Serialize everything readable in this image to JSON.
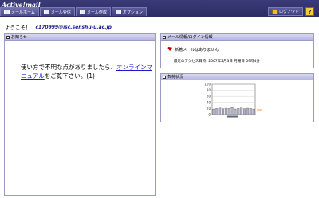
{
  "app": {
    "logo": "Active!mail"
  },
  "tabs": [
    {
      "label": "メールホーム",
      "icon": "home-icon"
    },
    {
      "label": "メール受信",
      "icon": "inbox-icon"
    },
    {
      "label": "メール作成",
      "icon": "compose-icon"
    },
    {
      "label": "オプション",
      "icon": "options-icon"
    }
  ],
  "header": {
    "logout_label": "ログアウト",
    "help_label": "?"
  },
  "welcome": {
    "greeting": "ようこそ！",
    "user_id": "c170999@isc.senshu-u.ac.jp"
  },
  "notice": {
    "title": "お知らせ",
    "text_before": "使い方で不明な点がありましたら、",
    "link_text": "オンラインマニュアル",
    "text_after": "をご覧下さい。(1)"
  },
  "mail_info": {
    "title": "メール情報/ログイン情報",
    "new_mail_text": "新着メールはありません",
    "last_access": "最近のアクセス日時: 2007年2月3日 月曜日 09時4分"
  },
  "load_status": {
    "title": "負荷状況"
  },
  "chart_data": {
    "type": "bar",
    "ylim": [
      0,
      100
    ],
    "y_ticks": [
      "100",
      "80",
      "60",
      "40",
      "20",
      "0"
    ],
    "values": [
      18,
      20,
      22,
      19,
      21,
      20,
      23,
      18,
      20,
      22,
      19,
      21,
      20,
      18
    ],
    "bar_color": "#b0b0c8"
  }
}
